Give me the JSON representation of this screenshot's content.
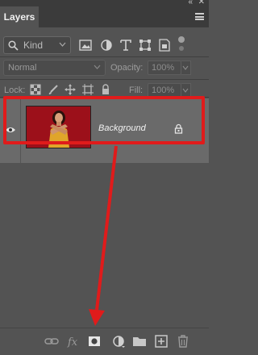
{
  "panel": {
    "tab_label": "Layers"
  },
  "filter": {
    "kind_label": "Kind"
  },
  "blend": {
    "mode": "Normal",
    "opacity_label": "Opacity:",
    "opacity_value": "100%"
  },
  "lock": {
    "label": "Lock:",
    "fill_label": "Fill:",
    "fill_value": "100%"
  },
  "layers": [
    {
      "name": "Background",
      "visible": true,
      "locked": true,
      "thumbnail": "red background portrait"
    }
  ],
  "colors": {
    "annotation": "#e01b1b",
    "panel_bg": "#535353",
    "selected_row": "#6a6a6a"
  }
}
